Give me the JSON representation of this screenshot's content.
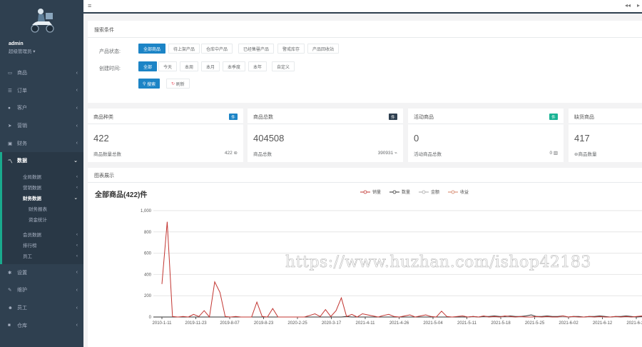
{
  "sidebar": {
    "user": {
      "name": "admin",
      "role": "超级管理员"
    },
    "items": [
      {
        "icon": "monitor-icon",
        "glyph": "▭",
        "label": "商品"
      },
      {
        "icon": "list-icon",
        "glyph": "☰",
        "label": "订单"
      },
      {
        "icon": "user-icon",
        "glyph": "●",
        "label": "客户"
      },
      {
        "icon": "send-icon",
        "glyph": "➤",
        "label": "营销"
      },
      {
        "icon": "money-icon",
        "glyph": "▣",
        "label": "财务"
      },
      {
        "icon": "line-chart-icon",
        "glyph": "〽",
        "label": "数据"
      }
    ],
    "sub_items": [
      {
        "label": "全局数据"
      },
      {
        "label": "营销数据"
      },
      {
        "label": "财务数据"
      }
    ],
    "sub_sub_items": [
      {
        "label": "财务报表"
      },
      {
        "label": "资金统计"
      }
    ],
    "sub_items2": [
      {
        "label": "会员数据"
      },
      {
        "label": "排行榜"
      },
      {
        "label": "员工"
      }
    ],
    "items2": [
      {
        "icon": "gear-icon",
        "glyph": "✱",
        "label": "设置"
      },
      {
        "icon": "wrench-icon",
        "glyph": "✎",
        "label": "维护"
      },
      {
        "icon": "users-icon",
        "glyph": "☻",
        "label": "员工"
      },
      {
        "icon": "store-icon",
        "glyph": "■",
        "label": "仓库"
      }
    ]
  },
  "topbar": {
    "menu_glyph": "≡",
    "prev_glyph": "◂◂",
    "next_glyph": "▸"
  },
  "search": {
    "title": "搜索条件",
    "status_label": "产品状态:",
    "status_options": [
      "全部商品",
      "待上架产品",
      "仓库中产品",
      "已经售罄产品",
      "警戒库存",
      "产品回收站"
    ],
    "date_label": "创建时间:",
    "date_options": [
      "全部",
      "今天",
      "本周",
      "本月",
      "本季度",
      "本年",
      "自定义"
    ],
    "search_button": "搜索",
    "reset_button": "刷新"
  },
  "cards": [
    {
      "title": "商品种类",
      "tag": "件",
      "tag_color": "#1c84c6",
      "value": "422",
      "note": "商品数量总数",
      "right": "422 ⊜"
    },
    {
      "title": "商品总数",
      "tag": "件",
      "tag_color": "#2f4050",
      "value": "404508",
      "note": "商品总数",
      "right": "390931 ⌁"
    },
    {
      "title": "活动商品",
      "tag": "件",
      "tag_color": "#1ab394",
      "value": "0",
      "note": "活动商品总数",
      "right": "0 ▥"
    },
    {
      "title": "缺货商品",
      "tag": "",
      "tag_color": "#ffffff",
      "value": "417",
      "note": "⊜商品数量",
      "right": ""
    }
  ],
  "chart_panel": {
    "title": "图表展示"
  },
  "chart_data": {
    "type": "line",
    "title": "全部商品(422)件",
    "xlabel": "",
    "ylabel": "",
    "ylim": [
      0,
      1000
    ],
    "y_ticks": [
      "0",
      "200",
      "400",
      "600",
      "800",
      "1,000"
    ],
    "x_tick_labels": [
      "2010-1-11",
      "2019-11-23",
      "2019-8-07",
      "2019-8-23",
      "2020-2-25",
      "2020-3-17",
      "2021-4-11",
      "2021-4-26",
      "2021-5-04",
      "2021-5-11",
      "2021-5-18",
      "2021-5-25",
      "2021-6-02",
      "2021-6-12",
      "2021-6-25"
    ],
    "series": [
      {
        "name": "销量",
        "color": "#c23531",
        "values": [
          310,
          895,
          5,
          0,
          5,
          0,
          25,
          5,
          60,
          0,
          330,
          230,
          5,
          0,
          5,
          0,
          0,
          0,
          140,
          5,
          0,
          80,
          0,
          0,
          0,
          0,
          0,
          0,
          15,
          30,
          5,
          70,
          5,
          60,
          180,
          5,
          25,
          0,
          30,
          20,
          10,
          0,
          15,
          25,
          5,
          0,
          10,
          20,
          0,
          10,
          20,
          5,
          0,
          55,
          5,
          0,
          5,
          10,
          0,
          5,
          0,
          10,
          0,
          5,
          0,
          10,
          5,
          0,
          5,
          0,
          0,
          5,
          0,
          5,
          0,
          0,
          10,
          0,
          5,
          0,
          0,
          5,
          0,
          5,
          0,
          0,
          5,
          0,
          5,
          0,
          5,
          10
        ]
      },
      {
        "name": "数量",
        "color": "#333333",
        "values": [
          0,
          0,
          0,
          0,
          0,
          0,
          0,
          0,
          0,
          0,
          0,
          0,
          0,
          0,
          0,
          0,
          0,
          0,
          0,
          0,
          0,
          0,
          0,
          0,
          0,
          0,
          0,
          0,
          0,
          0,
          0,
          0,
          0,
          0,
          0,
          5,
          0,
          0,
          0,
          0,
          0,
          0,
          0,
          0,
          0,
          0,
          0,
          0,
          0,
          0,
          0,
          0,
          0,
          0,
          0,
          0,
          0,
          0,
          0,
          5,
          0,
          5,
          5,
          10,
          5,
          5,
          10,
          5,
          5,
          10,
          20,
          5,
          5,
          10,
          5,
          5,
          10,
          0,
          5,
          5,
          0,
          5,
          5,
          10,
          5,
          0,
          5,
          5,
          10,
          5,
          0,
          5
        ]
      },
      {
        "name": "金额",
        "color": "#aaaaaa",
        "values": [
          0,
          0,
          0,
          0,
          0,
          0,
          0,
          0,
          0,
          0,
          0,
          0,
          0,
          0,
          0,
          0,
          0,
          0,
          0,
          0,
          0,
          0,
          0,
          0,
          0,
          0,
          0,
          0,
          0,
          0,
          0,
          0,
          0,
          0,
          0,
          0,
          0,
          0,
          0,
          0,
          0,
          0,
          0,
          0,
          0,
          0,
          0,
          0,
          0,
          0,
          0,
          0,
          0,
          0,
          0,
          0,
          0,
          0,
          0,
          0,
          0,
          0,
          0,
          0,
          0,
          0,
          0,
          0,
          0,
          0,
          0,
          0,
          0,
          0,
          0,
          0,
          0,
          0,
          0,
          0,
          0,
          0,
          0,
          0,
          0,
          0,
          0,
          0,
          0,
          0,
          0,
          0
        ]
      },
      {
        "name": "收益",
        "color": "#d48265",
        "values": [
          0,
          0,
          0,
          0,
          0,
          0,
          0,
          0,
          0,
          0,
          0,
          0,
          0,
          0,
          0,
          0,
          0,
          0,
          0,
          0,
          0,
          0,
          0,
          0,
          0,
          0,
          0,
          0,
          0,
          0,
          0,
          0,
          0,
          0,
          0,
          0,
          0,
          0,
          0,
          0,
          0,
          0,
          0,
          0,
          0,
          0,
          0,
          0,
          0,
          0,
          0,
          0,
          0,
          0,
          0,
          0,
          0,
          0,
          0,
          0,
          0,
          0,
          0,
          0,
          0,
          0,
          0,
          0,
          0,
          0,
          0,
          0,
          0,
          0,
          0,
          0,
          0,
          0,
          0,
          0,
          0,
          0,
          0,
          0,
          0,
          0,
          0,
          0,
          0,
          0,
          0,
          0
        ]
      }
    ]
  },
  "watermark": "https://www.huzhan.com/ishop42183"
}
